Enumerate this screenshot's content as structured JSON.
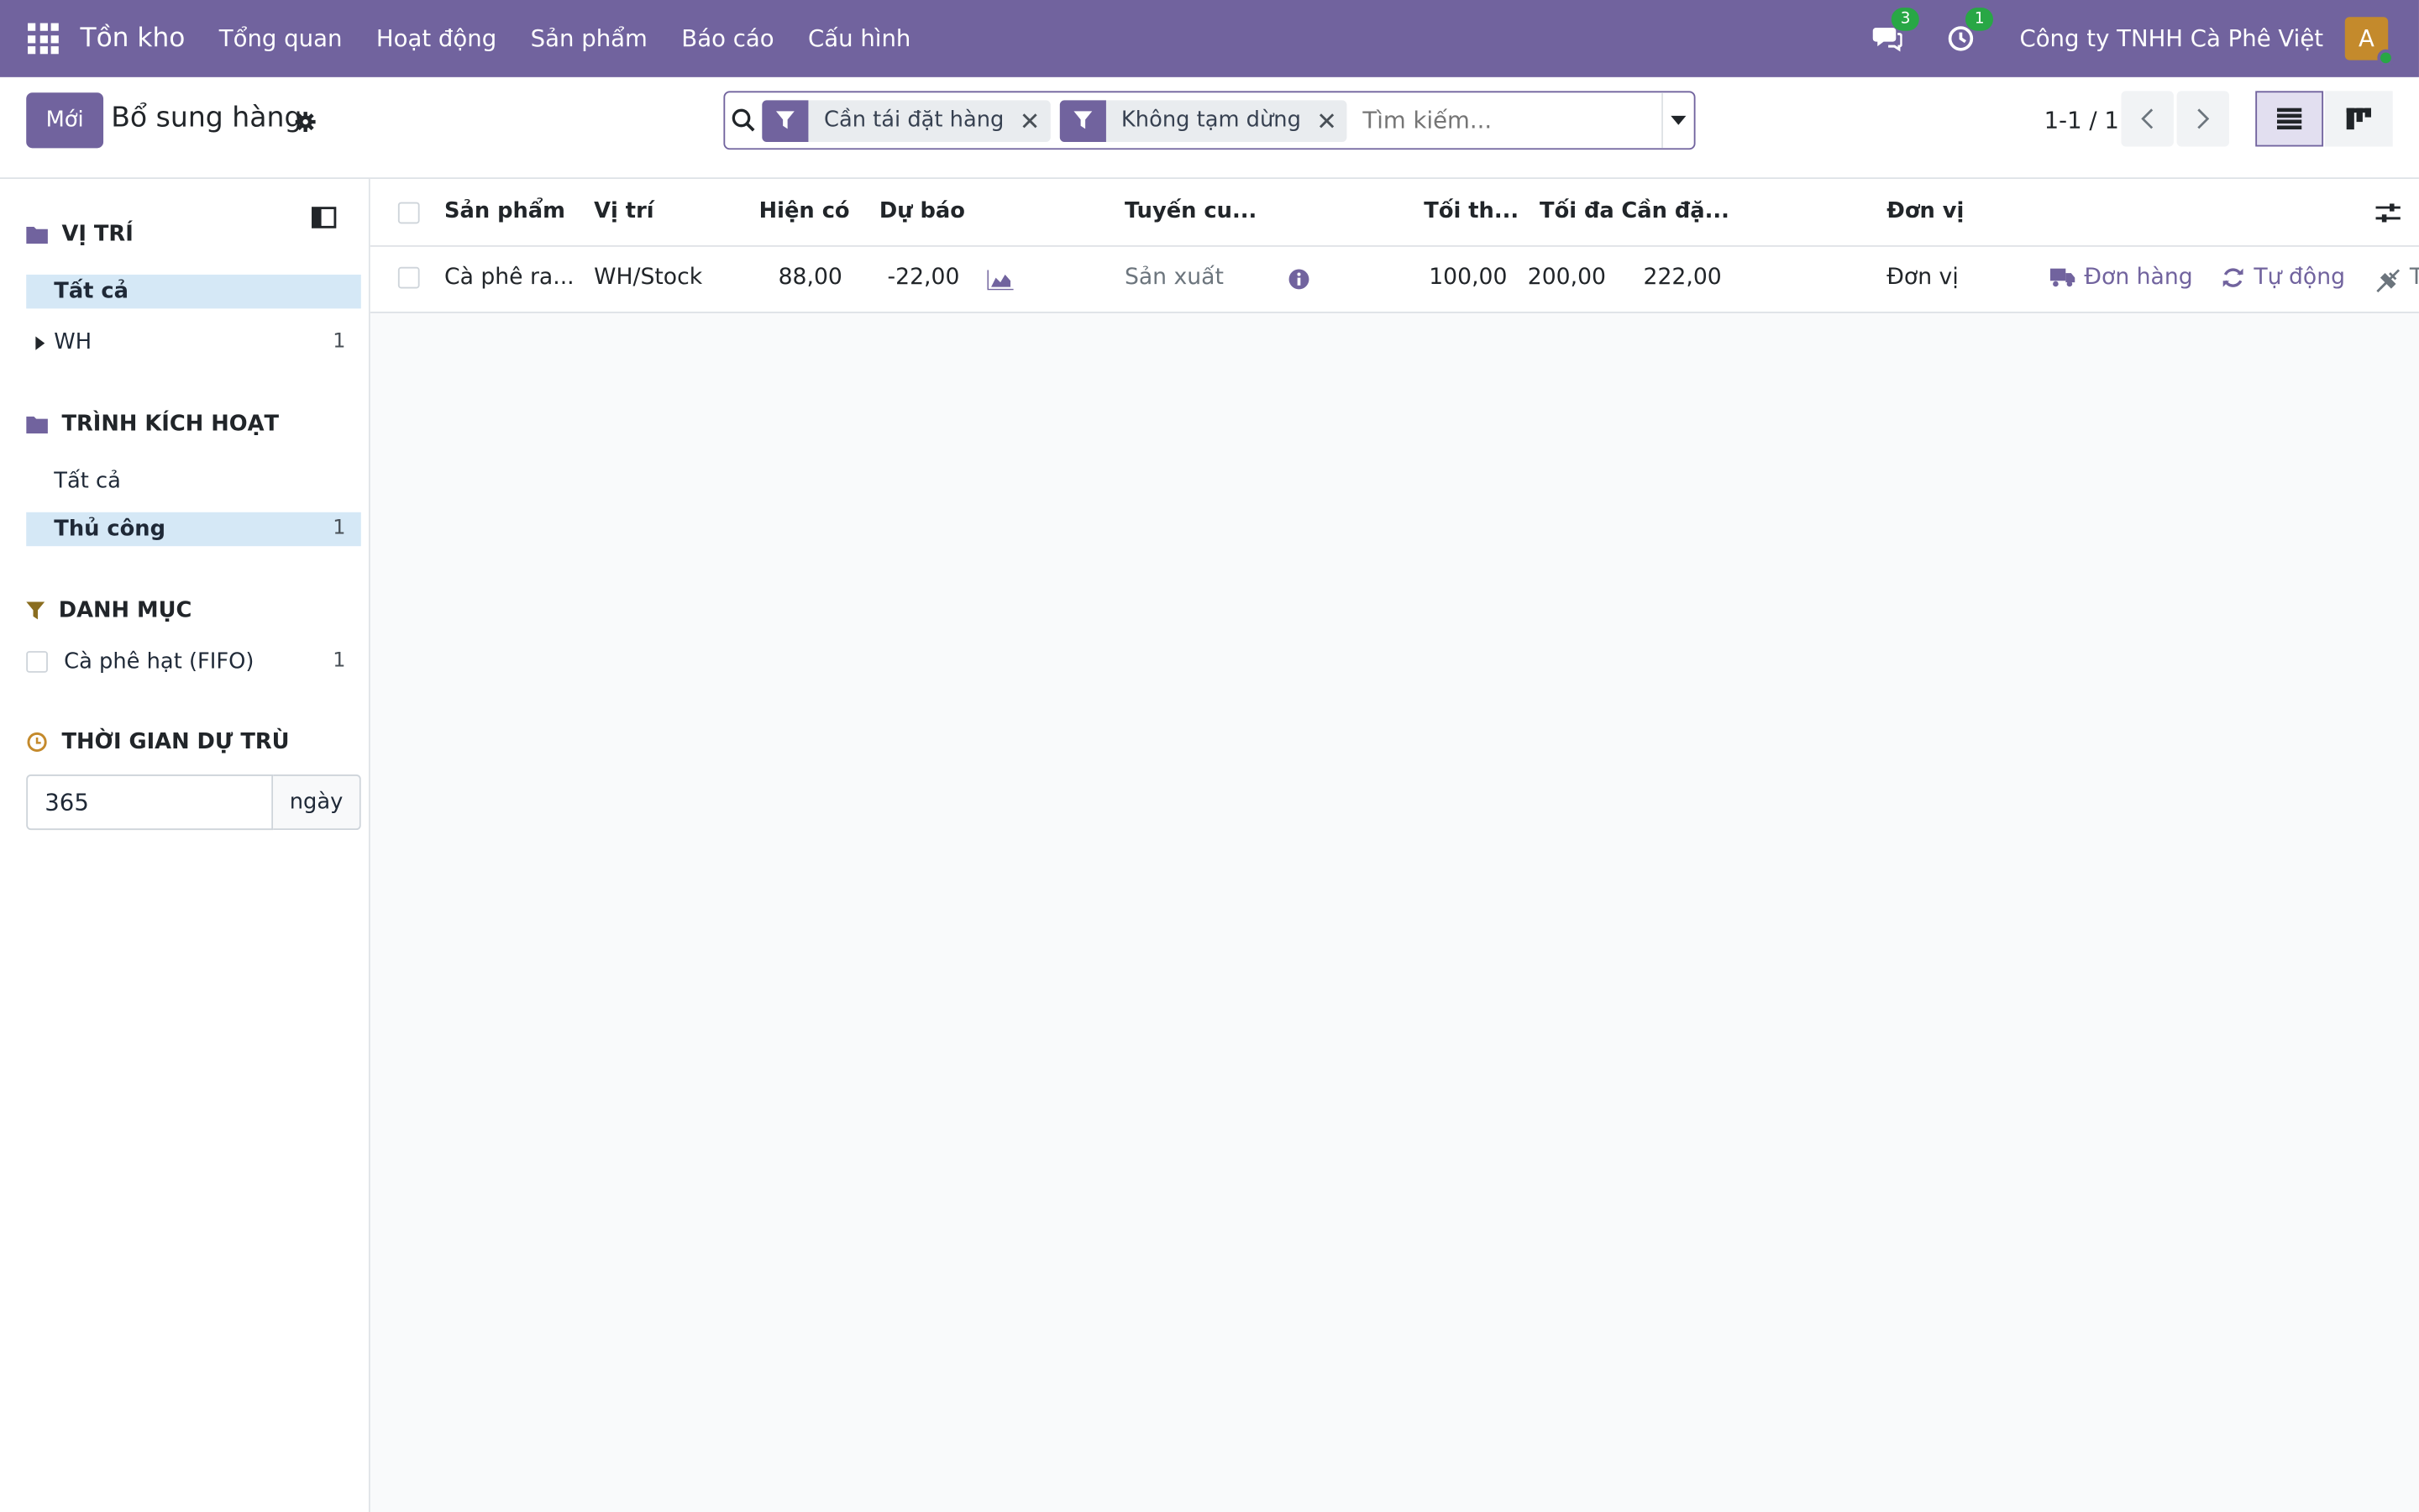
{
  "navbar": {
    "app_name": "Tồn kho",
    "menu": [
      "Tổng quan",
      "Hoạt động",
      "Sản phẩm",
      "Báo cáo",
      "Cấu hình"
    ],
    "messages_count": "3",
    "activities_count": "1",
    "company": "Công ty TNHH Cà Phê Việt",
    "avatar_letter": "A"
  },
  "control": {
    "new_label": "Mới",
    "title": "Bổ sung hàng",
    "facets": [
      "Cần tái đặt hàng",
      "Không tạm dừng"
    ],
    "search_placeholder": "Tìm kiếm...",
    "pager": "1-1 / 1"
  },
  "sidebar": {
    "location": {
      "title": "VỊ TRÍ",
      "all_label": "Tất cả",
      "items": [
        {
          "label": "WH",
          "count": "1"
        }
      ]
    },
    "trigger": {
      "title": "TRÌNH KÍCH HOẠT",
      "all_label": "Tất cả",
      "items": [
        {
          "label": "Thủ công",
          "count": "1"
        }
      ]
    },
    "category": {
      "title": "DANH MỤC",
      "items": [
        {
          "label": "Cà phê hạt (FIFO)",
          "count": "1"
        }
      ]
    },
    "horizon": {
      "title": "THỜI GIAN DỰ TRÙ",
      "value": "365",
      "unit": "ngày"
    }
  },
  "table": {
    "headers": {
      "product": "Sản phẩm",
      "location": "Vị trí",
      "on_hand": "Hiện có",
      "forecast": "Dự báo",
      "route": "Tuyến cu...",
      "min": "Tối th...",
      "max": "Tối đa",
      "to_order": "Cần đặ...",
      "uom": "Đơn vị"
    },
    "rows": [
      {
        "product": "Cà phê ra...",
        "location": "WH/Stock",
        "on_hand": "88,00",
        "forecast": "-22,00",
        "route": "Sản xuất",
        "min": "100,00",
        "max": "200,00",
        "to_order": "222,00",
        "uom": "Đơn vị",
        "action_order": "Đơn hàng",
        "action_auto": "Tự động"
      }
    ]
  },
  "colors": {
    "brand": "#71639e",
    "active_row": "#d5e8f6",
    "badge": "#28a745"
  }
}
